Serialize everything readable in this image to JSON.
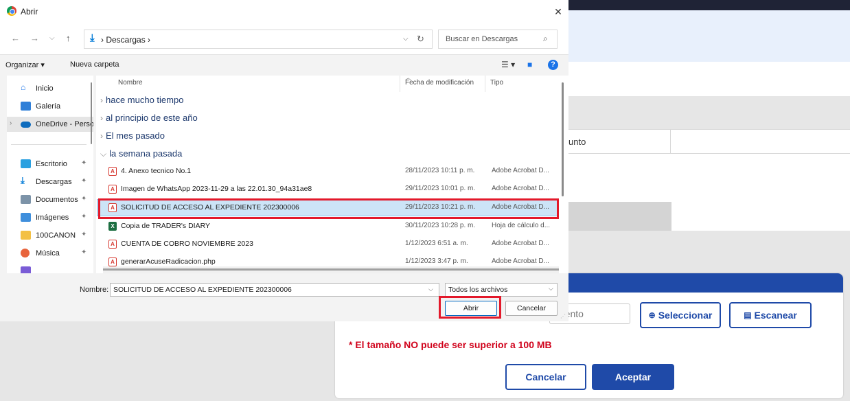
{
  "background": {
    "table_column_label": "unto",
    "doc_input_text": "mento",
    "select_button": "Seleccionar",
    "scan_button": "Escanear",
    "size_warning": "* El tamaño NO puede ser superior a 100 MB",
    "cancel_button": "Cancelar",
    "accept_button": "Aceptar",
    "colors": {
      "primary": "#1f4aa8",
      "warning": "#d0021b"
    }
  },
  "dialog": {
    "title": "Abrir",
    "address": "Descargas  ›",
    "search_placeholder": "Buscar en Descargas",
    "toolbar": {
      "organize": "Organizar ▾",
      "new_folder": "Nueva carpeta"
    },
    "nav_items": [
      {
        "label": "Inicio",
        "icon": "home-icon"
      },
      {
        "label": "Galería",
        "icon": "gallery-icon"
      },
      {
        "label": "OneDrive - Perso",
        "icon": "onedrive-icon"
      },
      {
        "label": "Escritorio",
        "icon": "desktop-icon"
      },
      {
        "label": "Descargas",
        "icon": "download-icon"
      },
      {
        "label": "Documentos",
        "icon": "documents-icon"
      },
      {
        "label": "Imágenes",
        "icon": "pictures-icon"
      },
      {
        "label": "100CANON",
        "icon": "folder-icon"
      },
      {
        "label": "Música",
        "icon": "music-icon"
      }
    ],
    "columns": {
      "name": "Nombre",
      "date": "Fecha de modificación",
      "type": "Tipo"
    },
    "groups": [
      "hace mucho tiempo",
      "al principio de este año",
      "El mes pasado",
      "la semana pasada"
    ],
    "files": [
      {
        "name": "4. Anexo tecnico No.1",
        "date": "28/11/2023 10:11 p. m.",
        "type": "Adobe Acrobat D...",
        "kind": "pdf"
      },
      {
        "name": "Imagen de WhatsApp 2023-11-29 a las 22.01.30_94a31ae8",
        "date": "29/11/2023 10:01 p. m.",
        "type": "Adobe Acrobat D...",
        "kind": "pdf"
      },
      {
        "name": "SOLICITUD DE ACCESO AL EXPEDIENTE 202300006",
        "date": "29/11/2023 10:21 p. m.",
        "type": "Adobe Acrobat D...",
        "kind": "pdf",
        "selected": true
      },
      {
        "name": "Copia de TRADER's DIARY",
        "date": "30/11/2023 10:28 p. m.",
        "type": "Hoja de cálculo d...",
        "kind": "xlsx"
      },
      {
        "name": "CUENTA DE COBRO NOVIEMBRE 2023",
        "date": "1/12/2023 6:51 a. m.",
        "type": "Adobe Acrobat D...",
        "kind": "pdf"
      },
      {
        "name": "generarAcuseRadicacion.php",
        "date": "1/12/2023 3:47 p. m.",
        "type": "Adobe Acrobat D...",
        "kind": "pdf"
      }
    ],
    "filename_label": "Nombre:",
    "filename_value": "SOLICITUD DE ACCESO AL EXPEDIENTE 202300006",
    "filter_value": "Todos los archivos",
    "open_button": "Abrir",
    "cancel_button": "Cancelar",
    "highlight_color": "#e3192b"
  }
}
